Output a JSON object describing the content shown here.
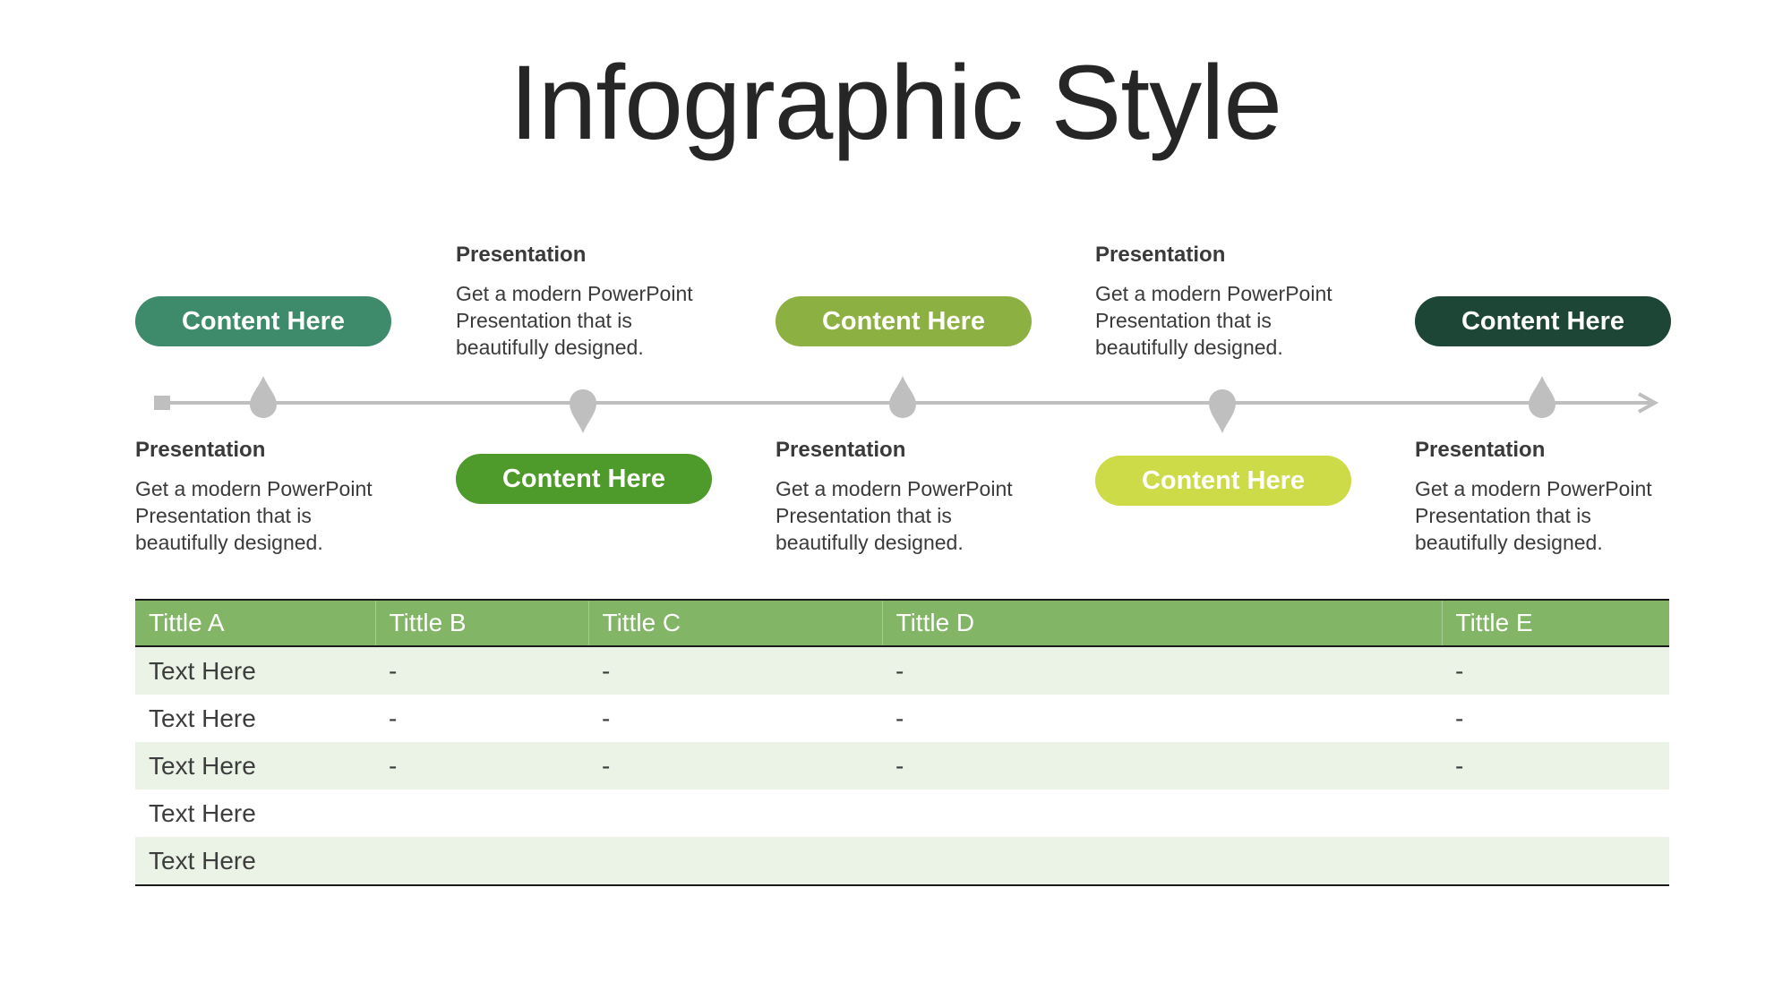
{
  "slide": {
    "title": "Infographic Style"
  },
  "timeline": {
    "steps": [
      {
        "label": "Content Here",
        "color": "#3d8b6a",
        "heading": "Presentation",
        "body": [
          "Get a modern PowerPoint",
          "Presentation that is",
          "beautifully designed."
        ]
      },
      {
        "label": "Content Here",
        "color": "#4e9a2a",
        "heading": "Presentation",
        "body": [
          "Get a modern PowerPoint",
          "Presentation that is",
          "beautifully designed."
        ]
      },
      {
        "label": "Content Here",
        "color": "#8db042",
        "heading": "Presentation",
        "body": [
          "Get a modern PowerPoint",
          "Presentation that is",
          "beautifully designed."
        ]
      },
      {
        "label": "Content Here",
        "color": "#cddb48",
        "heading": "Presentation",
        "body": [
          "Get a modern PowerPoint",
          "Presentation that is",
          "beautifully designed."
        ]
      },
      {
        "label": "Content Here",
        "color": "#1d4636",
        "heading": "Presentation",
        "body": [
          "Get a modern PowerPoint",
          "Presentation that is",
          "beautifully designed."
        ]
      }
    ],
    "line_color": "#bfbfbf"
  },
  "table": {
    "header_color": "#82b566",
    "stripe_color": "#ebf3e6",
    "headers": [
      "Tittle A",
      "Tittle B",
      "Tittle C",
      "Tittle D",
      "Tittle E"
    ],
    "rows": [
      [
        "Text Here",
        "-",
        "-",
        "-",
        "-"
      ],
      [
        "Text Here",
        "-",
        "-",
        "-",
        "-"
      ],
      [
        "Text Here",
        "-",
        "-",
        "-",
        "-"
      ],
      [
        "Text Here",
        "",
        "",
        "",
        ""
      ],
      [
        "Text Here",
        "",
        "",
        "",
        ""
      ]
    ]
  }
}
